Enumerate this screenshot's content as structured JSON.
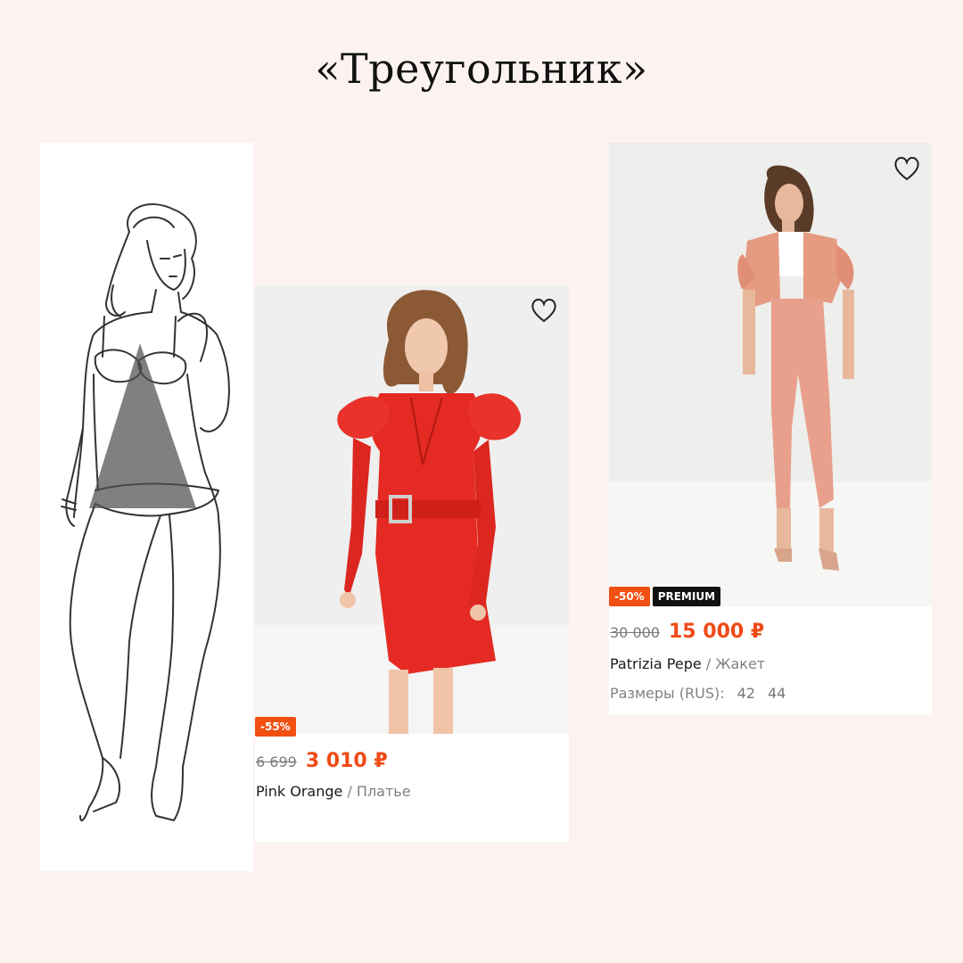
{
  "page": {
    "title": "«Треугольник»"
  },
  "products": [
    {
      "heart_icon": "heart-outline-icon",
      "badges": {
        "discount": "-55%"
      },
      "old_price": "6 699",
      "new_price": "3 010 ₽",
      "brand": "Pink Orange",
      "separator": " / ",
      "category": "Платье"
    },
    {
      "heart_icon": "heart-outline-icon",
      "badges": {
        "discount": "-50%",
        "premium": "PREMIUM"
      },
      "old_price": "30 000",
      "new_price": "15 000 ₽",
      "brand": "Patrizia Pepe",
      "separator": " / ",
      "category": "Жакет",
      "sizes_label": "Размеры (RUS):",
      "sizes": [
        "42",
        "44"
      ]
    }
  ],
  "colors": {
    "background": "#fcf3f1",
    "discount_badge": "#f24f13",
    "premium_badge": "#111111",
    "price_accent": "#f04a16",
    "dress_red": "#e42a23",
    "suit_peach": "#e8a08c"
  }
}
